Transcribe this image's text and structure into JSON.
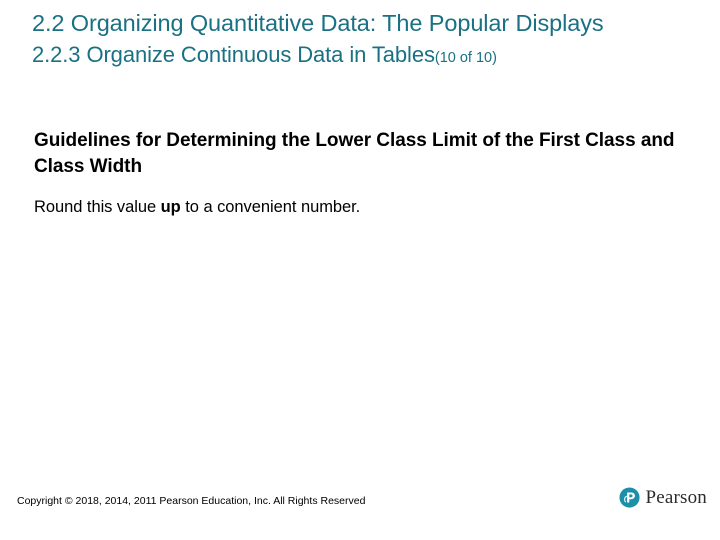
{
  "slide": {
    "background_color": "#ffffff",
    "title": {
      "main": "2.2 Organizing Quantitative Data: The Popular Displays",
      "subtitle": "2.2.3 Organize Continuous Data in Tables",
      "count_label": "(10 of 10)",
      "color": "#1A7183"
    },
    "body": {
      "heading": "Guidelines for Determining the Lower Class Limit of the First Class and Class Width",
      "paragraph_before": "Round this value ",
      "paragraph_emphasis": "up",
      "paragraph_after": " to a convenient number.",
      "color": "#000000"
    },
    "footer": {
      "copyright": "Copyright © 2018, 2014, 2011 Pearson Education, Inc. All Rights Reserved",
      "logo_text": "Pearson",
      "logo_icon": "pearson-p-circle-icon",
      "logo_color": "#1E8FA8"
    }
  }
}
